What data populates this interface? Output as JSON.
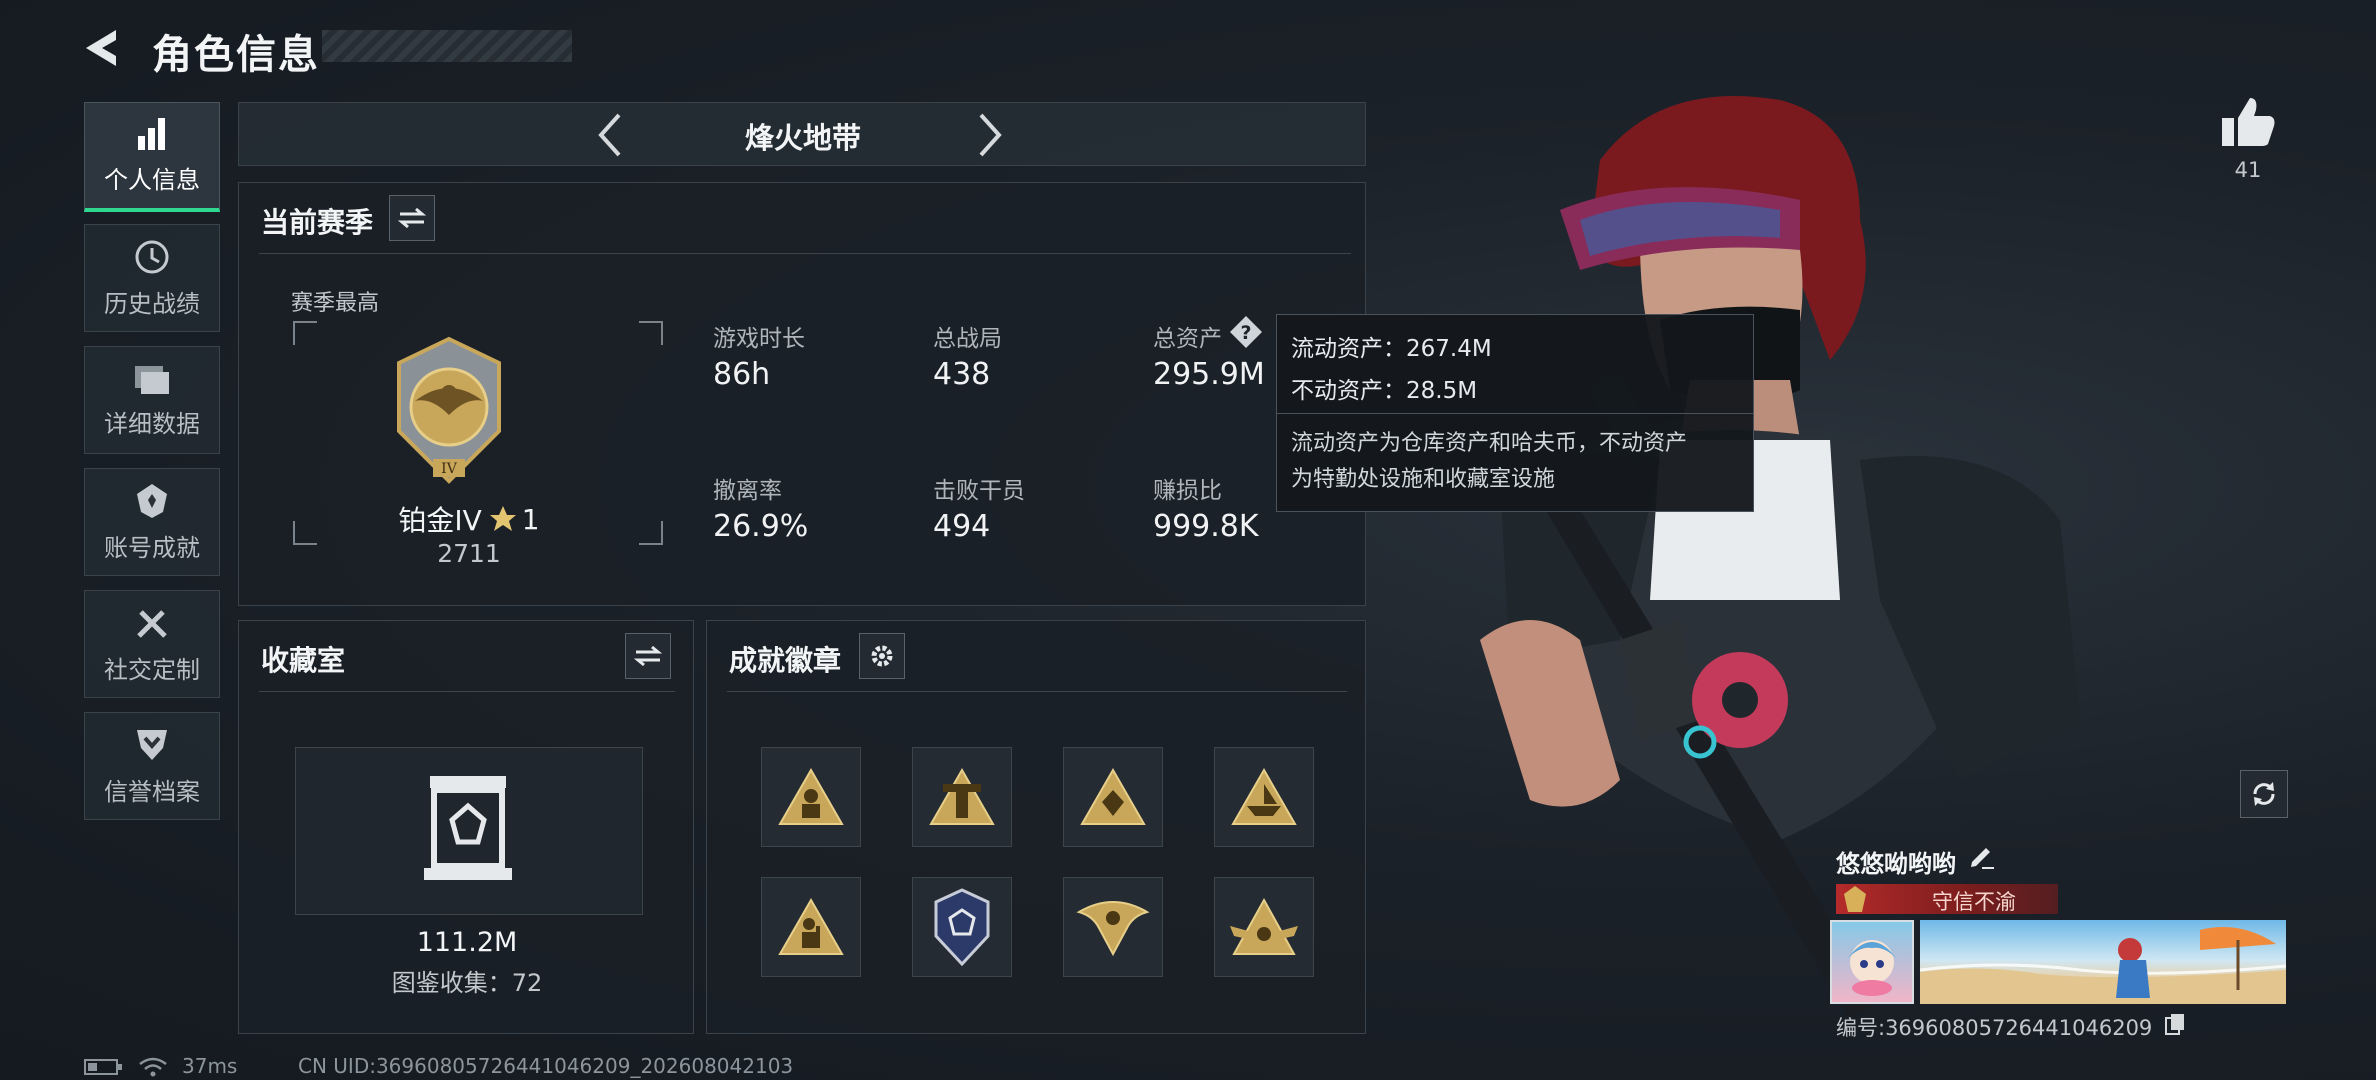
{
  "header": {
    "title": "角色信息"
  },
  "sidebar": {
    "items": [
      {
        "label": "个人信息",
        "icon": "bar-chart-icon",
        "active": true
      },
      {
        "label": "历史战绩",
        "icon": "history-clock-icon"
      },
      {
        "label": "详细数据",
        "icon": "folder-icon"
      },
      {
        "label": "账号成就",
        "icon": "achievement-icon"
      },
      {
        "label": "社交定制",
        "icon": "tools-icon"
      },
      {
        "label": "信誉档案",
        "icon": "credit-shield-icon"
      }
    ]
  },
  "mode_selector": {
    "label": "烽火地带"
  },
  "season": {
    "title": "当前赛季",
    "peak_label": "赛季最高",
    "rank_name": "铂金IV",
    "rank_stars": "1",
    "rank_score": "2711",
    "stats": [
      {
        "label": "游戏时长",
        "value": "86h"
      },
      {
        "label": "总战局",
        "value": "438"
      },
      {
        "label": "总资产",
        "value": "295.9M"
      },
      {
        "label": "撤离率",
        "value": "26.9%"
      },
      {
        "label": "击败干员",
        "value": "494"
      },
      {
        "label": "赚损比",
        "value": "999.8K"
      }
    ]
  },
  "tooltip": {
    "line1": "流动资产：267.4M",
    "line2": "不动资产：28.5M",
    "desc1": "流动资产为仓库资产和哈夫币，不动资产",
    "desc2": "为特勤处设施和收藏室设施"
  },
  "collection": {
    "title": "收藏室",
    "value": "111.2M",
    "count": "图鉴收集：72"
  },
  "achievements": {
    "title": "成就徽章",
    "badges": [
      "badge-triangle-figure-icon",
      "badge-triangle-tower-icon",
      "badge-triangle-gem-icon",
      "badge-triangle-ship-icon",
      "badge-triangle-soldier-icon",
      "badge-shield-blue-icon",
      "badge-eagle-icon",
      "badge-triangle-wings-icon"
    ]
  },
  "likes": {
    "count": "41"
  },
  "player": {
    "name": "悠悠呦哟哟",
    "title_tag": "守信不渝",
    "id_text": "编号:369608057264410462​09"
  },
  "status_bar": {
    "ping": "37ms",
    "uid": "CN UID:369608057264410462​09_202608042103"
  },
  "colors": {
    "accent": "#2fd88f",
    "gold": "#c9a75a",
    "title_red": "#7a1d1d"
  }
}
